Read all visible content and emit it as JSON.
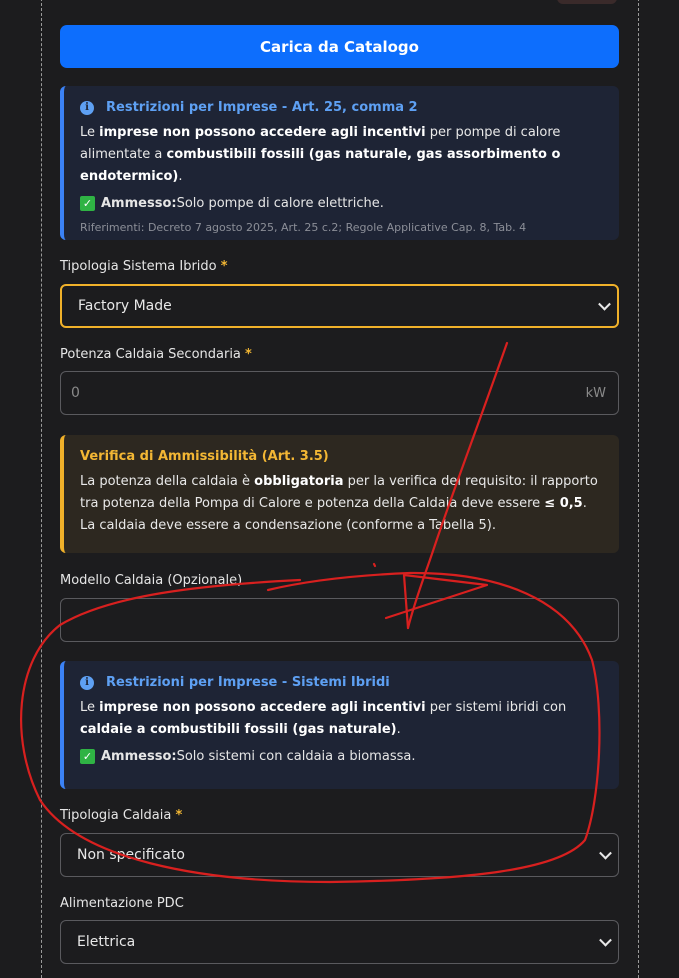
{
  "catalog_button": "Carica da Catalogo",
  "alert1": {
    "title": "Restrizioni per Imprese - Art. 25, comma 2",
    "p_a": "Le ",
    "p_b": "imprese non possono accedere agli incentivi",
    "p_c": " per pompe di calore alimentate a ",
    "p_d": "combustibili fossili (gas naturale, gas assorbimento o endotermico)",
    "p_e": ".",
    "ok_label": "Ammesso:",
    "ok_text": " Solo pompe di calore elettriche.",
    "refs": "Riferimenti: Decreto 7 agosto 2025, Art. 25 c.2; Regole Applicative Cap. 8, Tab. 4"
  },
  "hybrid_type": {
    "label": "Tipologia Sistema Ibrido",
    "required": "*",
    "value": "Factory Made"
  },
  "boiler_power": {
    "label": "Potenza Caldaia Secondaria",
    "required": "*",
    "value": "0",
    "unit": "kW"
  },
  "alert_warn": {
    "title": "Verifica di Ammissibilità (Art. 3.5)",
    "p_a": "La potenza della caldaia è ",
    "p_b": "obbligatoria",
    "p_c": " per la verifica del requisito: il rapporto tra potenza della Pompa di Calore e potenza della Caldaia deve essere ",
    "p_d": "≤ 0,5",
    "p_e": ". La caldaia deve essere a condensazione (conforme a Tabella 5)."
  },
  "boiler_model": {
    "label": "Modello Caldaia (Opzionale)",
    "value": ""
  },
  "alert2": {
    "title": "Restrizioni per Imprese - Sistemi Ibridi",
    "p_a": "Le ",
    "p_b": "imprese non possono accedere agli incentivi",
    "p_c": " per sistemi ibridi con ",
    "p_d": "caldaie a combustibili fossili (gas naturale)",
    "p_e": ".",
    "ok_label": "Ammesso:",
    "ok_text": " Solo sistemi con caldaia a biomassa."
  },
  "boiler_type": {
    "label": "Tipologia Caldaia",
    "required": "*",
    "value": "Non specificato"
  },
  "pdc_power": {
    "label": "Alimentazione PDC",
    "value": "Elettrica"
  },
  "colors": {
    "primary": "#0d6efd",
    "info": "#3b82f6",
    "warning": "#f0b12a",
    "ok": "#2fb344",
    "annotation": "#d8201f"
  }
}
